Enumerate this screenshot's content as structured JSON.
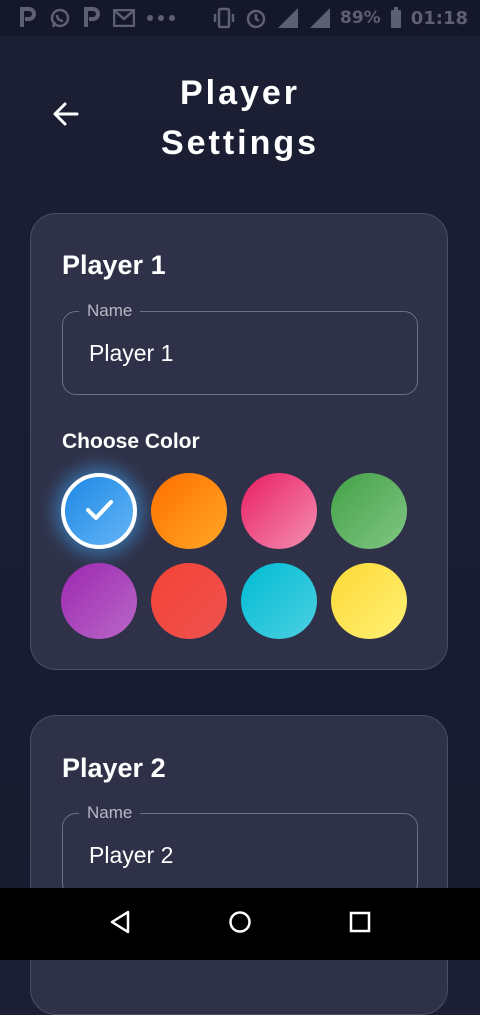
{
  "status_bar": {
    "left_icons": [
      "p-icon",
      "whatsapp-icon",
      "p-icon",
      "gmail-icon",
      "more-dots-icon"
    ],
    "right_icons": [
      "vibrate-icon",
      "alarm-icon",
      "signal-4g-icon",
      "signal-icon"
    ],
    "battery": "89%",
    "time": "01:18"
  },
  "header": {
    "title": "Player Settings",
    "back_icon": "arrow-back-icon"
  },
  "players": [
    {
      "title": "Player 1",
      "name_label": "Name",
      "name_value": "Player 1",
      "color_section_label": "Choose Color",
      "selected_color_index": 0
    },
    {
      "title": "Player 2",
      "name_label": "Name",
      "name_value": "Player 2"
    }
  ],
  "colors": [
    {
      "name": "blue",
      "from": "#1e88e5",
      "to": "#64b5f6"
    },
    {
      "name": "orange",
      "from": "#ff6f00",
      "to": "#ffa726"
    },
    {
      "name": "pink",
      "from": "#e91e63",
      "to": "#f48fb1"
    },
    {
      "name": "green",
      "from": "#43a047",
      "to": "#81c784"
    },
    {
      "name": "purple",
      "from": "#9c27b0",
      "to": "#ba68c8"
    },
    {
      "name": "red",
      "from": "#f44336",
      "to": "#ef5350"
    },
    {
      "name": "cyan",
      "from": "#00bcd4",
      "to": "#4dd0e1"
    },
    {
      "name": "yellow",
      "from": "#fdd835",
      "to": "#fff176"
    }
  ],
  "nav": {
    "back_icon": "nav-back-triangle-icon",
    "home_icon": "nav-home-circle-icon",
    "recents_icon": "nav-recents-square-icon"
  }
}
